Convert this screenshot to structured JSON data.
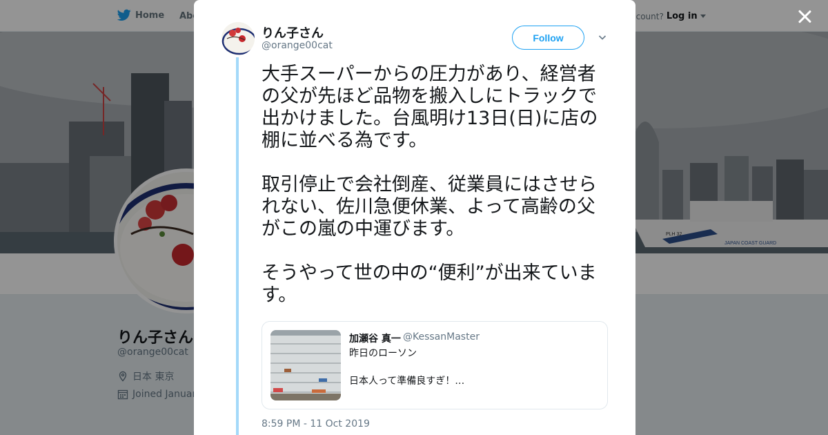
{
  "nav": {
    "home_label": "Home",
    "about_label": "Abo",
    "account_prompt": "ccount?",
    "login_label": "Log in"
  },
  "profile": {
    "name": "りん子さん",
    "handle": "@orange00cat",
    "location": "日本 東京",
    "joined": "Joined Januar"
  },
  "tweet": {
    "author_name": "りん子さん",
    "author_handle": "@orange00cat",
    "follow_label": "Follow",
    "paragraphs": [
      "大手スーパーからの圧力があり、経営者の父が先ほど品物を搬入しにトラックで出かけました。台風明け13日(日)に店の棚に並べる為です。",
      "取引停止で会社倒産、従業員にはさせられない、佐川急便休業、よって高齢の父がこの嵐の中運びます。",
      "そうやって世の中の“便利”が出来ています。"
    ],
    "timestamp": "8:59 PM - 11 Oct 2019"
  },
  "quoted": {
    "name": "加瀬谷 真一",
    "handle": "@KessanMaster",
    "line1": "昨日のローソン",
    "line2": "日本人って準備良すぎ！…"
  },
  "banner_sign": "JAPAN COAST GUARD",
  "ship_id": "PLH 32",
  "colors": {
    "accent": "#1da1f2",
    "thread_line": "#a4d9f9",
    "text_primary": "#14171a",
    "text_secondary": "#657786"
  }
}
